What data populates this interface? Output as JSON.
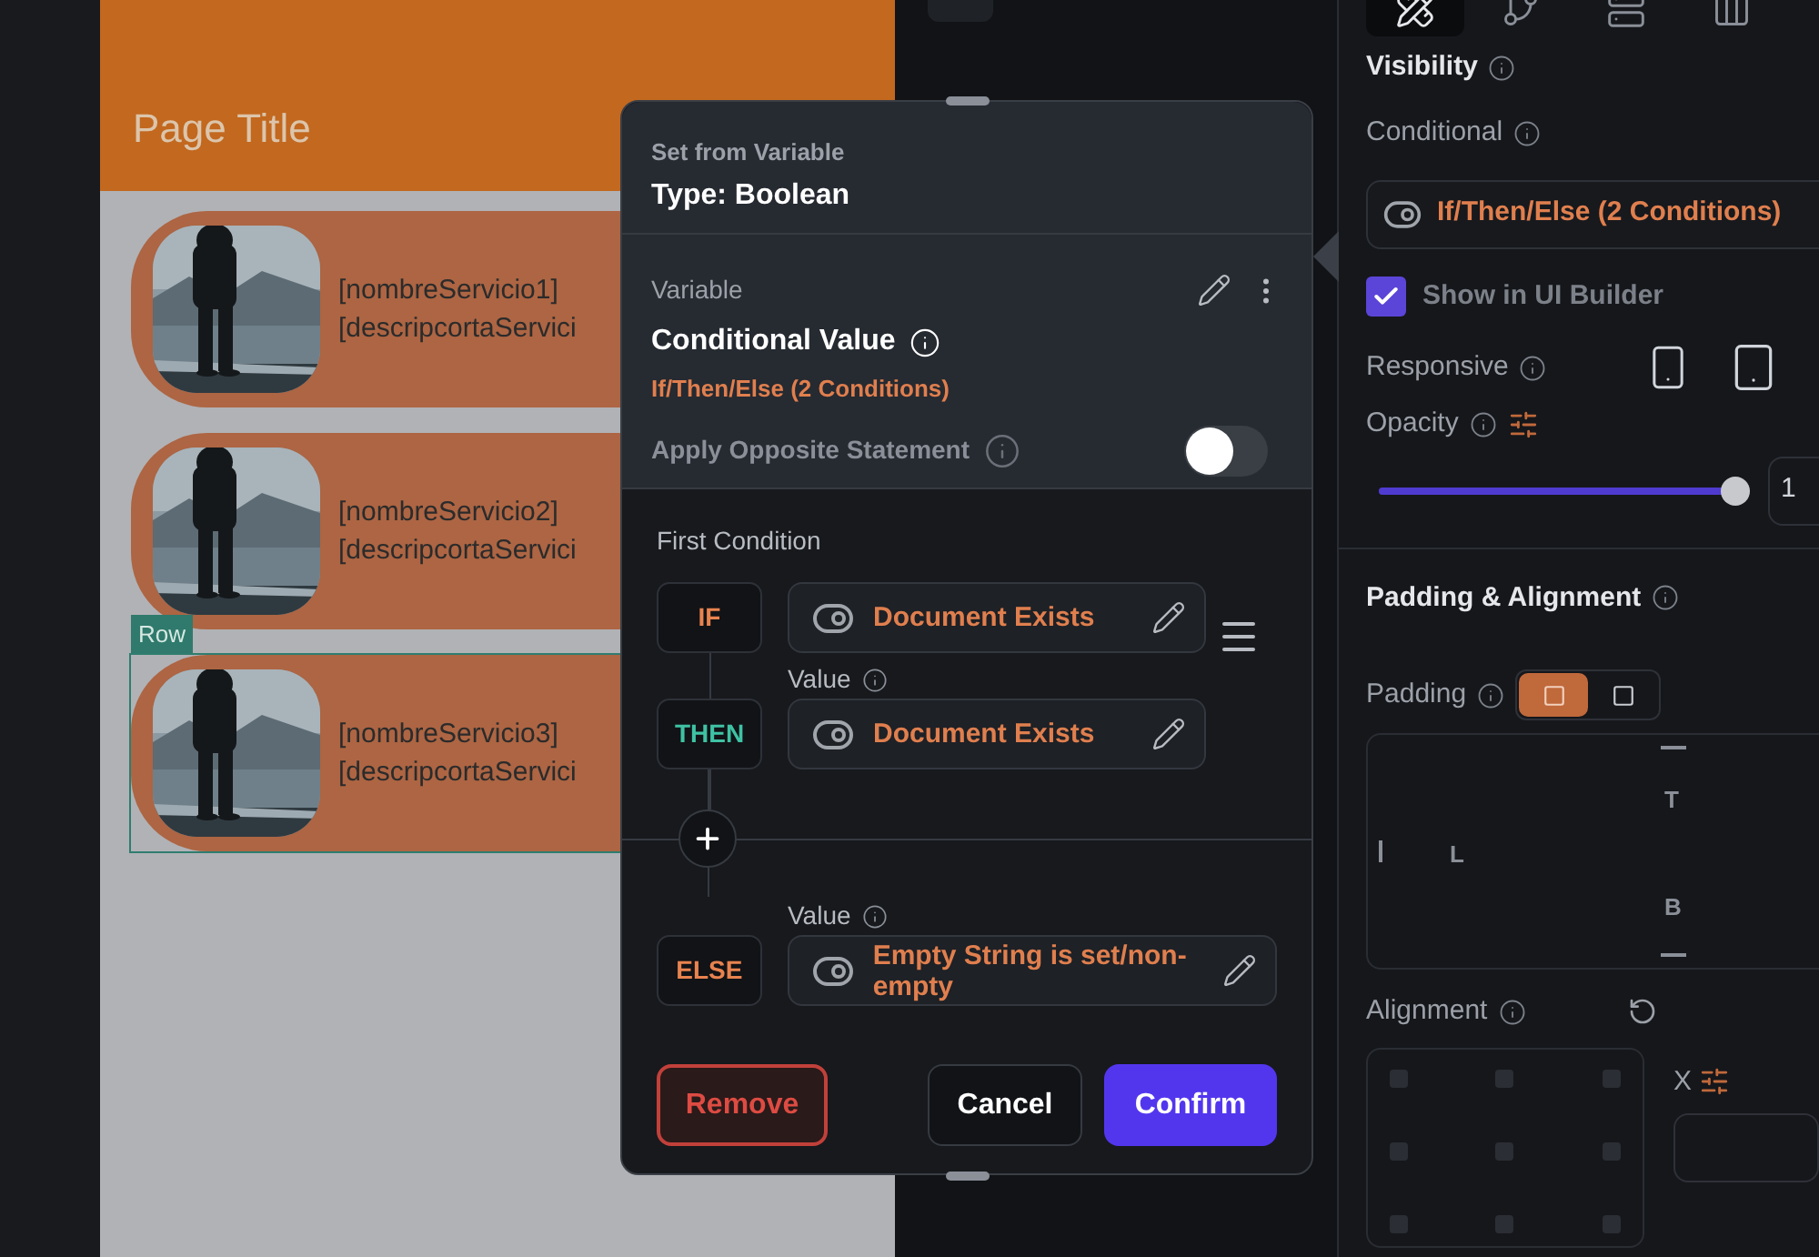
{
  "canvas": {
    "page_title": "Page Title",
    "selection_label": "Row",
    "cards": [
      {
        "name": "[nombreServicio1]",
        "description": "[descripcortaServici",
        "selected": false
      },
      {
        "name": "[nombreServicio2]",
        "description": "[descripcortaServici",
        "selected": false
      },
      {
        "name": "[nombreServicio3]",
        "description": "[descripcortaServici",
        "selected": true
      }
    ]
  },
  "dialog": {
    "title": "Set from Variable",
    "type": "Type: Boolean",
    "variable_label": "Variable",
    "variable_name": "Conditional Value",
    "variable_summary": "If/Then/Else (2 Conditions)",
    "opposite_label": "Apply Opposite Statement",
    "opposite_on": false,
    "section_title": "First Condition",
    "conditions": [
      {
        "kind": "if",
        "keyword": "IF",
        "value": "Document Exists"
      },
      {
        "kind": "then",
        "keyword": "THEN",
        "label": "Value",
        "value": "Document Exists"
      },
      {
        "kind": "else",
        "keyword": "ELSE",
        "label": "Value",
        "value": "Empty String is set/non-empty"
      }
    ],
    "buttons": {
      "remove": "Remove",
      "cancel": "Cancel",
      "confirm": "Confirm"
    }
  },
  "properties": {
    "tabs": [
      {
        "selected": true
      },
      {
        "selected": false
      },
      {
        "selected": false
      },
      {
        "selected": false
      }
    ],
    "visibility_title": "Visibility",
    "conditional_label": "Conditional",
    "conditional_value": "If/Then/Else (2 Conditions)",
    "show_in_builder": {
      "label": "Show in UI Builder",
      "checked": true
    },
    "responsive_label": "Responsive",
    "opacity": {
      "label": "Opacity",
      "level": 1.0,
      "value": "1"
    },
    "padding_title": "Padding & Alignment",
    "padding_label": "Padding",
    "padding_modes": [
      {
        "selected": true
      },
      {
        "selected": false
      }
    ],
    "padding_sides": {
      "top": "T",
      "left": "L",
      "bottom": "B"
    },
    "alignment_label": "Alignment",
    "x_label": "X"
  }
}
